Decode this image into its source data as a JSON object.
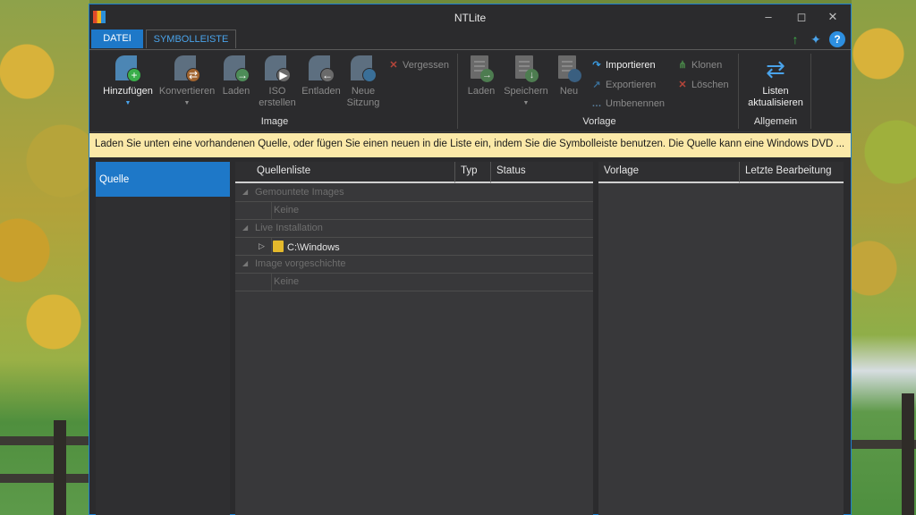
{
  "window": {
    "title": "NTLite"
  },
  "tabs": {
    "datei": "DATEI",
    "symbolleiste": "SYMBOLLEISTE"
  },
  "ribbon": {
    "image_group": {
      "label": "Image",
      "buttons": [
        {
          "label": "Hinzufügen",
          "icon": "add-plus-icon",
          "enabled": true
        },
        {
          "label": "Konvertieren",
          "icon": "convert-icon",
          "enabled": false
        },
        {
          "label": "Laden",
          "icon": "load-arrow-icon",
          "enabled": false
        },
        {
          "label_line1": "ISO",
          "label_line2": "erstellen",
          "icon": "iso-disc-icon",
          "enabled": false
        },
        {
          "label": "Entladen",
          "icon": "unload-arrow-icon",
          "enabled": false
        },
        {
          "label_line1": "Neue",
          "label_line2": "Sitzung",
          "icon": "new-session-icon",
          "enabled": false
        }
      ],
      "vergessen": "Vergessen"
    },
    "vorlage_group": {
      "label": "Vorlage",
      "laden": "Laden",
      "speichern": "Speichern",
      "neu": "Neu",
      "importieren": "Importieren",
      "exportieren": "Exportieren",
      "umbenennen": "Umbenennen",
      "klonen": "Klonen",
      "loeschen": "Löschen"
    },
    "allgemein_group": {
      "label": "Allgemein",
      "listen_line1": "Listen",
      "listen_line2": "aktualisieren"
    }
  },
  "infobar": {
    "text": "Laden Sie unten eine vorhandenen Quelle, oder fügen Sie einen neuen in die Liste ein, indem Sie die Symbolleiste benutzen. Die Quelle kann eine Windows DVD ..."
  },
  "sidebar": {
    "quelle": "Quelle"
  },
  "source_list": {
    "columns": [
      "Quellenliste",
      "Typ",
      "Status"
    ],
    "rows": [
      {
        "label": "Gemountete Images",
        "kind": "group"
      },
      {
        "label": "Keine",
        "kind": "empty"
      },
      {
        "label": "Live Installation",
        "kind": "group"
      },
      {
        "label": "C:\\Windows",
        "kind": "item"
      },
      {
        "label": "Image vorgeschichte",
        "kind": "group"
      },
      {
        "label": "Keine",
        "kind": "empty"
      }
    ]
  },
  "template_list": {
    "columns": [
      "Vorlage",
      "Letzte Bearbeitung"
    ]
  },
  "colors": {
    "accent": "#1e78c8",
    "infobar_bg": "#fbe9a8",
    "window_bg": "#2b2b2d"
  }
}
